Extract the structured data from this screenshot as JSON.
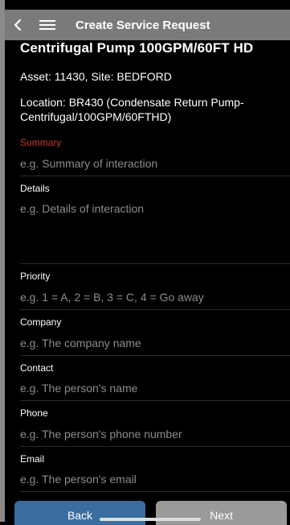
{
  "header": {
    "title": "Create Service Request"
  },
  "asset": {
    "title": "Centrifugal Pump 100GPM/60FT HD",
    "asset_site": "Asset: 11430, Site: BEDFORD",
    "location": "Location: BR430 (Condensate Return Pump-Centrifugal/100GPM/60FTHD)"
  },
  "form": {
    "summary": {
      "label": "Summary",
      "placeholder": "e.g. Summary of interaction"
    },
    "details": {
      "label": "Details",
      "placeholder": "e.g. Details of interaction"
    },
    "priority": {
      "label": "Priority",
      "placeholder": "e.g. 1 = A, 2 = B, 3 = C, 4 = Go away"
    },
    "company": {
      "label": "Company",
      "placeholder": "e.g. The company name"
    },
    "contact": {
      "label": "Contact",
      "placeholder": "e.g. The person's name"
    },
    "phone": {
      "label": "Phone",
      "placeholder": "e.g. The person's phone number"
    },
    "email": {
      "label": "Email",
      "placeholder": "e.g. The person's email"
    }
  },
  "buttons": {
    "back": "Back",
    "next": "Next"
  },
  "colors": {
    "header_bg": "#7a7a7a",
    "error_label": "#c0392b",
    "back_button": "#3a6e9e",
    "next_button": "#9a9a9a"
  }
}
